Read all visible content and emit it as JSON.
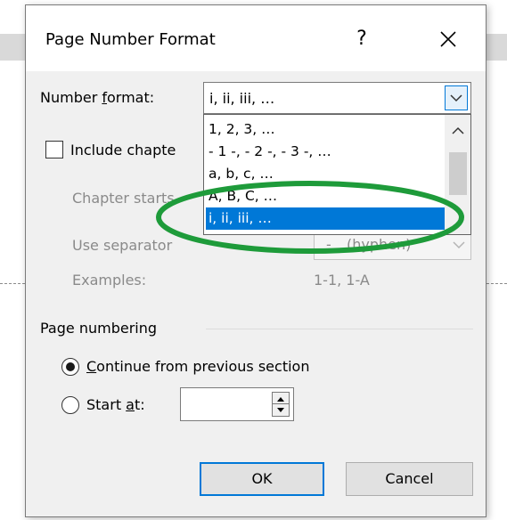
{
  "dialog": {
    "title": "Page Number Format",
    "help_label": "?"
  },
  "number_format": {
    "label_pre": "Number ",
    "label_accel": "f",
    "label_post": "ormat:",
    "value": "i, ii, iii, …"
  },
  "dropdown": {
    "items": [
      "1, 2, 3, …",
      "- 1 -, - 2 -, - 3 -, …",
      "a, b, c, …",
      "A, B, C, …",
      "i, ii, iii, …"
    ],
    "selected_index": 4
  },
  "include_chapter": {
    "label": "Include chapte",
    "checked": false
  },
  "chapter_starts": {
    "label": "Chapter starts"
  },
  "use_separator": {
    "label": "Use separator",
    "value_prefix": "-",
    "value_text": "(hyphen)"
  },
  "examples": {
    "label": "Examples:",
    "value": "1-1, 1-A"
  },
  "page_numbering": {
    "heading": "Page numbering",
    "continue_accel": "C",
    "continue_rest": "ontinue from previous section",
    "start_pre": "Start ",
    "start_accel": "a",
    "start_post": "t:",
    "start_value": "",
    "selected": "continue"
  },
  "buttons": {
    "ok": "OK",
    "cancel": "Cancel"
  },
  "colors": {
    "selection": "#0078d7",
    "annotation": "#1e9b3a"
  }
}
